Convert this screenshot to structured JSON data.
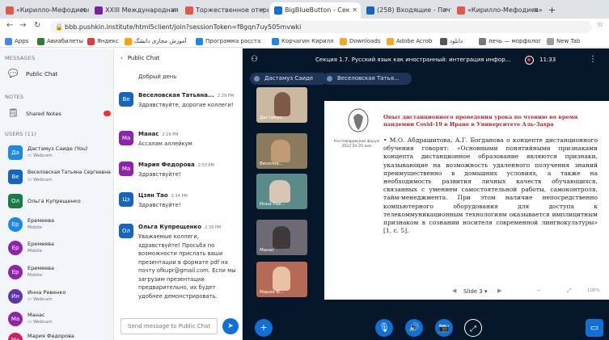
{
  "browser": {
    "tabs": [
      {
        "title": "«Кирилло-Мефодиевски»",
        "color": "#e2574c"
      },
      {
        "title": "XXIII Международная н",
        "color": "#7b1fa2"
      },
      {
        "title": "Торжественное откры",
        "color": "#e2574c"
      },
      {
        "title": "BigBlueButton - Сек",
        "color": "#0f70d7"
      },
      {
        "title": "(258) Входящие - Почт",
        "color": "#1565c0"
      },
      {
        "title": "«Кирилло-Мефодиев»",
        "color": "#e2574c"
      }
    ],
    "new_tab_symbol": "+",
    "url": "bbb.pushkin.institute/html5client/join?sessionToken=f8gqn7uy505mvwki",
    "bookmarks": [
      "Apps",
      "Авиабилеты",
      "Яндекс",
      "آموزش مجازی دانشگ",
      "Программа расста",
      "Корчагин Кирилл",
      "Downloads",
      "Adobe Acrob",
      "دانلود",
      "лечь — морфолог",
      "New Tab"
    ]
  },
  "sidebar": {
    "messages_title": "MESSAGES",
    "public_chat": "Public Chat",
    "notes_title": "NOTES",
    "shared_notes": "Shared Notes",
    "users_title": "USERS (11)",
    "users": [
      {
        "initials": "Да",
        "name": "Дастамуз Саиде",
        "suffix": "(You)",
        "sub": "Webcam",
        "color": "#1e88e5"
      },
      {
        "initials": "Ве",
        "name": "Веселовская Татьяна Сергеевна",
        "suffix": "",
        "sub": "Webcam",
        "color": "#1565c0"
      },
      {
        "initials": "Ол",
        "name": "Ольга Купрещенко",
        "suffix": "",
        "sub": "",
        "color": "#1a7a4a"
      },
      {
        "initials": "Ер",
        "name": "Еремеева",
        "suffix": "",
        "sub": "Mobile",
        "color": "#1e88e5"
      },
      {
        "initials": "Ер",
        "name": "Еремеева",
        "suffix": "",
        "sub": "Mobile",
        "color": "#8e24aa"
      },
      {
        "initials": "Ер",
        "name": "Еремеева",
        "suffix": "",
        "sub": "Mobile",
        "color": "#8e24aa"
      },
      {
        "initials": "Ин",
        "name": "Инна Ревенко",
        "suffix": "",
        "sub": "Webcam",
        "color": "#5e35b1"
      },
      {
        "initials": "Ма",
        "name": "Манас",
        "suffix": "",
        "sub": "Webcam",
        "color": "#8e24aa"
      },
      {
        "initials": "Ма",
        "name": "Мария Федорова",
        "suffix": "",
        "sub": "",
        "color": "#d81b60"
      }
    ]
  },
  "chat": {
    "back_label": "Public Chat",
    "messages": [
      {
        "initials": "",
        "name": "",
        "time": "",
        "text": "Добрый день",
        "color": "#fff"
      },
      {
        "initials": "Ве",
        "name": "Веселовская Татьяна...",
        "time": "2:29 PM",
        "text": "Здравствуйте, дорогие коллеги!",
        "color": "#1565c0"
      },
      {
        "initials": "Ма",
        "name": "Манас",
        "time": "2:29 PM",
        "text": "Ассалам аллейкум",
        "color": "#8e24aa"
      },
      {
        "initials": "Ма",
        "name": "Мария Федорова",
        "time": "2:33 PM",
        "text": "Здравствуйте!",
        "color": "#8e24aa"
      },
      {
        "initials": "Цэ",
        "name": "Цзян Тао",
        "time": "2:34 PM",
        "text": "Здравствуйте!",
        "color": "#1565c0"
      },
      {
        "initials": "Ол",
        "name": "Ольга Купрещенко",
        "time": "2:39 PM",
        "text": "Уважаемые коллеги, здравствуйте! Просьба по возможности прислать ваши презентации в формате pdf на почту ofkupr@gmail.com. Если мы загрузим презентации предварительно, их будет удобнее демонстрировать.",
        "color": "#1565c0"
      }
    ],
    "placeholder": "Send message to Public Chat"
  },
  "main": {
    "title": "Секция 1.7. Русский язык как иностранный: интеграция инфор...",
    "time": "11:33",
    "pills": [
      "Дастамуз Саиде",
      "Се",
      "Веселовская Татья..."
    ],
    "videos": [
      {
        "label": "Дастамуз...",
        "bg": "#c9b7a0"
      },
      {
        "label": "Веселов...",
        "bg": "#8a7a5e"
      },
      {
        "label": "Инна Рев...",
        "bg": "#5a8a8a"
      },
      {
        "label": "Манас",
        "bg": "#6d6a74"
      },
      {
        "label": "Мария Ф...",
        "bg": "#b46a55"
      }
    ]
  },
  "slide": {
    "heading": "Опыт дистанционного проведения урока по чтению во время пандемии Covid-19 в Иране в Университете Аль-Захра",
    "forum": "Костомаровский форум 2022 24–25 мая",
    "body": "М.О. Абдрашитова, А.Г. Богданова о концепте дистанционного обучения говорят: «Основными понятийными признаками концепта дистанционное образование являются признаки, указывающие на возможность удаленного получения знаний преимущественно в домашних условиях, а также на необходимость развития личных качеств обучающихся, связанных с умением самостоятельной работы, самоконтроля, тайм-менеджмента. При этом наличие непосредственно компьютерного оборудования для доступа к телекоммуникационным технологиям оказывается имплицитным признаком в сознании носителя современной лингвокультуры» [1, с. 5].",
    "slide_selector": "Slide 3",
    "zoom": "100%"
  }
}
